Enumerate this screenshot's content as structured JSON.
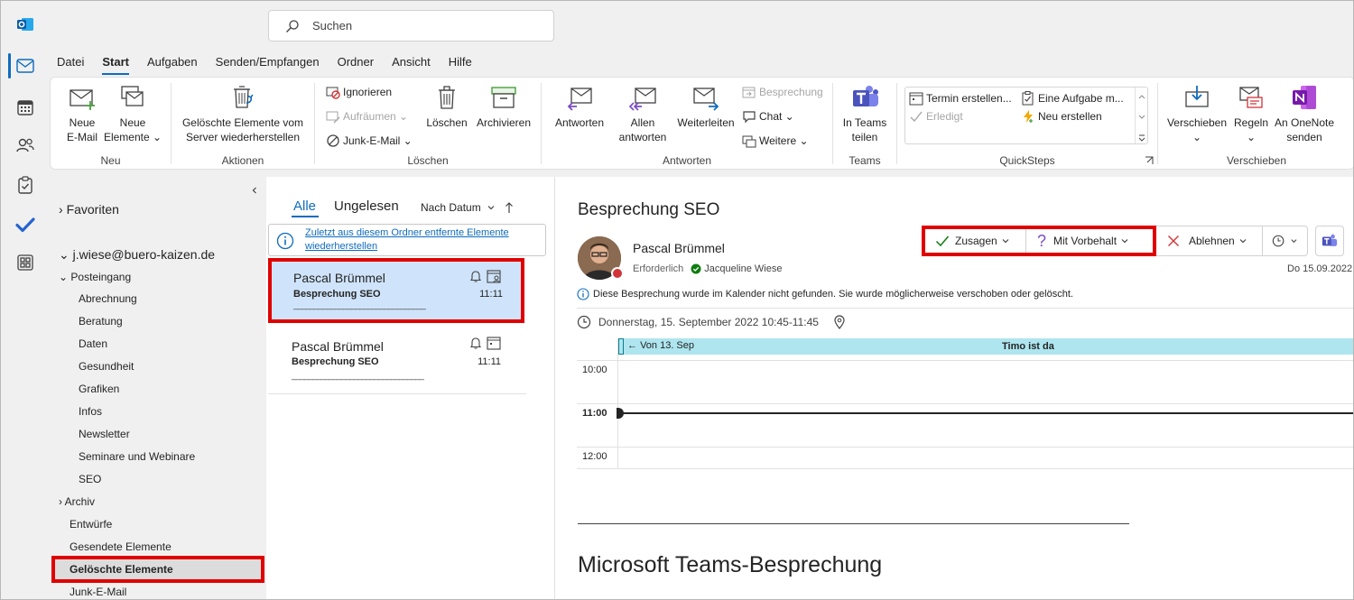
{
  "search": {
    "placeholder": "Suchen"
  },
  "menu": {
    "tabs": [
      "Datei",
      "Start",
      "Aufgaben",
      "Senden/Empfangen",
      "Ordner",
      "Ansicht",
      "Hilfe"
    ],
    "active": "Start"
  },
  "ribbon": {
    "neu": {
      "label": "Neu",
      "new_email": [
        "Neue",
        "E-Mail"
      ],
      "new_items": [
        "Neue",
        "Elemente ⌄"
      ]
    },
    "aktionen": {
      "label": "Aktionen",
      "restore": [
        "Gelöschte Elemente vom",
        "Server wiederherstellen"
      ]
    },
    "loeschen": {
      "label": "Löschen",
      "ignore": "Ignorieren",
      "cleanup": "Aufräumen ⌄",
      "junk": "Junk-E-Mail ⌄",
      "delete": "Löschen",
      "archive": "Archivieren"
    },
    "antworten": {
      "label": "Antworten",
      "reply": "Antworten",
      "reply_all": [
        "Allen",
        "antworten"
      ],
      "forward": "Weiterleiten",
      "meeting": "Besprechung",
      "chat": "Chat ⌄",
      "more": "Weitere ⌄"
    },
    "teams": {
      "label": "Teams",
      "share": [
        "In Teams",
        "teilen"
      ]
    },
    "quicksteps": {
      "label": "QuickSteps",
      "items": [
        "Termin erstellen...",
        "Erledigt",
        "Eine Aufgabe m...",
        "Neu erstellen"
      ]
    },
    "verschieben": {
      "label": "Verschieben",
      "move": [
        "Verschieben",
        "⌄"
      ],
      "rules": [
        "Regeln",
        "⌄"
      ],
      "onenote": [
        "An OneNote",
        "senden"
      ]
    }
  },
  "folders": {
    "favorites": "Favoriten",
    "account": "j.wiese@buero-kaizen.de",
    "inbox": "Posteingang",
    "subfolders": [
      "Abrechnung",
      "Beratung",
      "Daten",
      "Gesundheit",
      "Grafiken",
      "Infos",
      "Newsletter",
      "Seminare und Webinare",
      "SEO"
    ],
    "archive": "Archiv",
    "others": [
      "Entwürfe",
      "Gesendete Elemente"
    ],
    "deleted": "Gelöschte Elemente",
    "junk": "Junk-E-Mail"
  },
  "message_list": {
    "tab_all": "Alle",
    "tab_unread": "Ungelesen",
    "sort": "Nach Datum",
    "info": [
      "Zuletzt aus diesem Ordner entfernte Elemente",
      "wiederherstellen"
    ],
    "messages": [
      {
        "from": "Pascal Brümmel",
        "subject": "Besprechung SEO",
        "time": "11:11",
        "preview": "________________________________"
      },
      {
        "from": "Pascal Brümmel",
        "subject": "Besprechung SEO",
        "time": "11:11",
        "preview": "________________________________"
      }
    ]
  },
  "reading": {
    "title": "Besprechung SEO",
    "sender": "Pascal Brümmel",
    "required_label": "Erforderlich",
    "attendee": "Jacqueline Wiese",
    "date_short": "Do 15.09.2022",
    "accept": "Zusagen",
    "tentative": "Mit Vorbehalt",
    "decline": "Ablehnen",
    "notice": "Diese Besprechung wurde im Kalender nicht gefunden. Sie wurde möglicherweise verschoben oder gelöscht.",
    "when": "Donnerstag, 15. September 2022 10:45-11:45",
    "calendar": {
      "banner_left": "Von 13. Sep",
      "banner_center": "Timo ist da",
      "hours": [
        "10:00",
        "11:00",
        "12:00"
      ]
    },
    "teams_heading": "Microsoft Teams-Besprechung"
  }
}
